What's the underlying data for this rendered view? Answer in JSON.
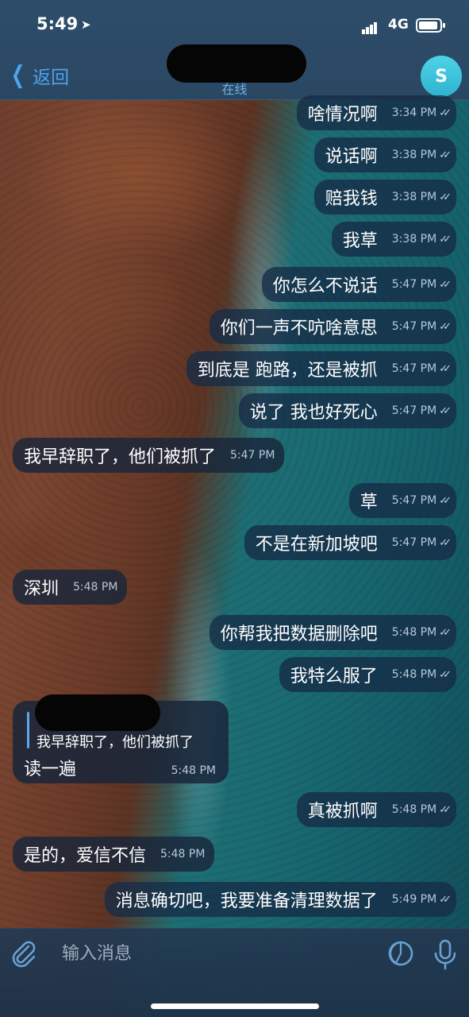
{
  "status_bar": {
    "time": "5:49",
    "network": "4G"
  },
  "header": {
    "back_label": "返回",
    "presence": "在线",
    "avatar_letter": "S"
  },
  "messages": [
    {
      "text": "啥情况啊",
      "time": "3:34 PM",
      "ticks": "✓✓"
    },
    {
      "text": "说话啊",
      "time": "3:38 PM",
      "ticks": "✓✓"
    },
    {
      "text": "赔我钱",
      "time": "3:38 PM",
      "ticks": "✓✓"
    },
    {
      "text": "我草",
      "time": "3:38 PM",
      "ticks": "✓✓"
    },
    {
      "text": "你怎么不说话",
      "time": "5:47 PM",
      "ticks": "✓✓"
    },
    {
      "text": "你们一声不吭啥意思",
      "time": "5:47 PM",
      "ticks": "✓✓"
    },
    {
      "text": "到底是 跑路，还是被抓",
      "time": "5:47 PM",
      "ticks": "✓✓"
    },
    {
      "text": "说了 我也好死心",
      "time": "5:47 PM",
      "ticks": "✓✓"
    },
    {
      "text": "我早辞职了，他们被抓了",
      "time": "5:47 PM"
    },
    {
      "text": "草",
      "time": "5:47 PM",
      "ticks": "✓✓"
    },
    {
      "text": "不是在新加坡吧",
      "time": "5:47 PM",
      "ticks": "✓✓"
    },
    {
      "text": "深圳",
      "time": "5:48 PM"
    },
    {
      "text": "你帮我把数据删除吧",
      "time": "5:48 PM",
      "ticks": "✓✓"
    },
    {
      "text": "我特么服了",
      "time": "5:48 PM",
      "ticks": "✓✓"
    },
    {
      "quote": "我早辞职了，他们被抓了",
      "text": "读一遍",
      "time": "5:48 PM"
    },
    {
      "text": "真被抓啊",
      "time": "5:48 PM",
      "ticks": "✓✓"
    },
    {
      "text": "是的，爱信不信",
      "time": "5:48 PM"
    },
    {
      "text": "消息确切吧，我要准备清理数据了",
      "time": "5:49 PM",
      "ticks": "✓✓"
    }
  ],
  "input": {
    "placeholder": "输入消息"
  },
  "icons": {
    "attach": "paperclip-icon",
    "sticker": "sticker-icon",
    "mic": "microphone-icon",
    "back": "chevron-left-icon",
    "location": "location-arrow-icon"
  },
  "colors": {
    "accent": "#4ea3ee",
    "avatar": "#3cc4dc"
  }
}
